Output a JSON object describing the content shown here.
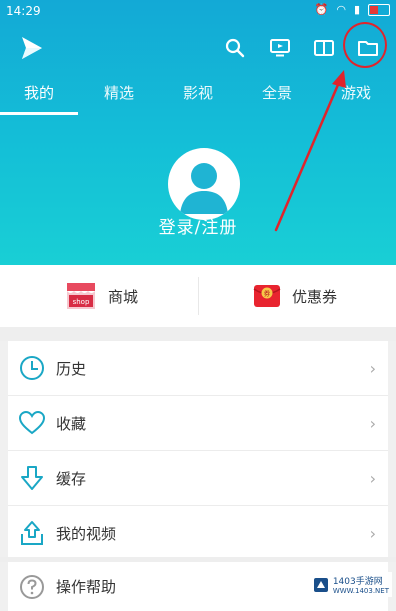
{
  "status": {
    "time": "14:29"
  },
  "tabs": [
    {
      "label": "我的"
    },
    {
      "label": "精选"
    },
    {
      "label": "影视"
    },
    {
      "label": "全景"
    },
    {
      "label": "游戏"
    }
  ],
  "user": {
    "login_label": "登录/注册"
  },
  "shortcuts": {
    "shop_label": "商城",
    "shop_icon_text": "shop",
    "coupon_label": "优惠券",
    "coupon_icon_text": "券"
  },
  "menu": [
    {
      "label": "历史",
      "icon": "clock-icon"
    },
    {
      "label": "收藏",
      "icon": "heart-icon"
    },
    {
      "label": "缓存",
      "icon": "download-icon"
    },
    {
      "label": "我的视频",
      "icon": "upload-icon"
    }
  ],
  "help": {
    "label": "操作帮助",
    "icon": "question-icon"
  },
  "watermark": {
    "line1": "1403手游网",
    "line2": "WWW.1403.NET"
  },
  "colors": {
    "header_top": "#13a9d6",
    "header_bottom": "#19cfd5",
    "accent": "#1aa7c5",
    "annotation": "#e0242c"
  }
}
